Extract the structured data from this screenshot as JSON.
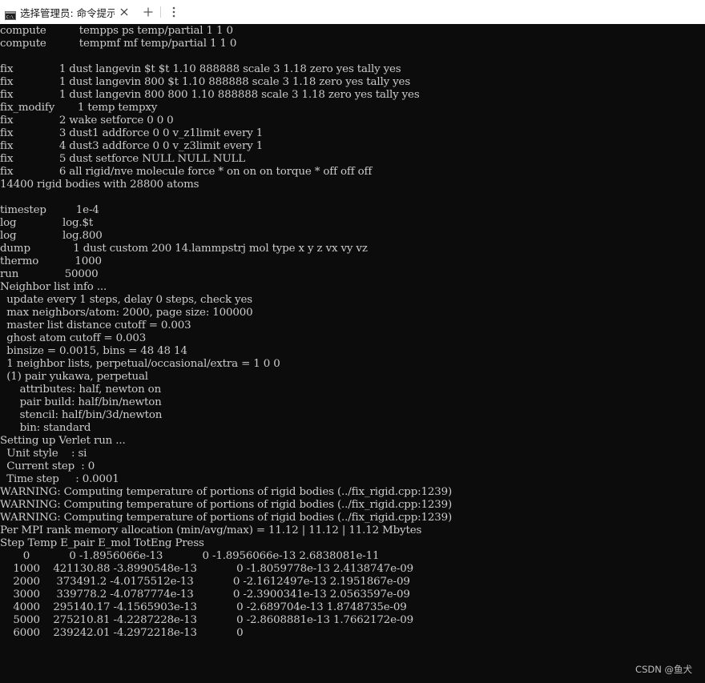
{
  "window": {
    "tab_title": "选择管理员: 命令提示符",
    "tab_icon": "cmd-prompt-icon",
    "close_icon": "close-icon",
    "new_tab_icon": "plus-icon",
    "menu_icon": "vertical-dots-icon"
  },
  "console": {
    "lines": [
      "compute          tempps ps temp/partial 1 1 0",
      "compute          tempmf mf temp/partial 1 1 0",
      "",
      "fix              1 dust langevin $t $t 1.10 888888 scale 3 1.18 zero yes tally yes",
      "fix              1 dust langevin 800 $t 1.10 888888 scale 3 1.18 zero yes tally yes",
      "fix              1 dust langevin 800 800 1.10 888888 scale 3 1.18 zero yes tally yes",
      "fix_modify       1 temp tempxy",
      "fix              2 wake setforce 0 0 0",
      "fix              3 dust1 addforce 0 0 v_z1limit every 1",
      "fix              4 dust3 addforce 0 0 v_z3limit every 1",
      "fix              5 dust setforce NULL NULL NULL",
      "fix              6 all rigid/nve molecule force * on on on torque * off off off",
      "14400 rigid bodies with 28800 atoms",
      "",
      "timestep         1e-4",
      "log              log.$t",
      "log              log.800",
      "dump             1 dust custom 200 14.lammpstrj mol type x y z vx vy vz",
      "thermo           1000",
      "run              50000",
      "Neighbor list info ...",
      "  update every 1 steps, delay 0 steps, check yes",
      "  max neighbors/atom: 2000, page size: 100000",
      "  master list distance cutoff = 0.003",
      "  ghost atom cutoff = 0.003",
      "  binsize = 0.0015, bins = 48 48 14",
      "  1 neighbor lists, perpetual/occasional/extra = 1 0 0",
      "  (1) pair yukawa, perpetual",
      "      attributes: half, newton on",
      "      pair build: half/bin/newton",
      "      stencil: half/bin/3d/newton",
      "      bin: standard",
      "Setting up Verlet run ...",
      "  Unit style    : si",
      "  Current step  : 0",
      "  Time step     : 0.0001",
      "WARNING: Computing temperature of portions of rigid bodies (../fix_rigid.cpp:1239)",
      "WARNING: Computing temperature of portions of rigid bodies (../fix_rigid.cpp:1239)",
      "WARNING: Computing temperature of portions of rigid bodies (../fix_rigid.cpp:1239)",
      "Per MPI rank memory allocation (min/avg/max) = 11.12 | 11.12 | 11.12 Mbytes",
      "Step Temp E_pair E_mol TotEng Press",
      "       0            0 -1.8956066e-13            0 -1.8956066e-13 2.6838081e-11",
      "    1000    421130.88 -3.8990548e-13            0 -1.8059778e-13 2.4138747e-09",
      "    2000     373491.2 -4.0175512e-13            0 -2.1612497e-13 2.1951867e-09",
      "    3000     339778.2 -4.0787774e-13            0 -2.3900341e-13 2.0563597e-09",
      "    4000    295140.17 -4.1565903e-13            0 -2.689704e-13 1.8748735e-09",
      "    5000    275210.81 -4.2287228e-13            0 -2.8608881e-13 1.7662172e-09",
      "    6000    239242.01 -4.2972218e-13            0"
    ]
  },
  "watermark": "CSDN @鱼犬"
}
